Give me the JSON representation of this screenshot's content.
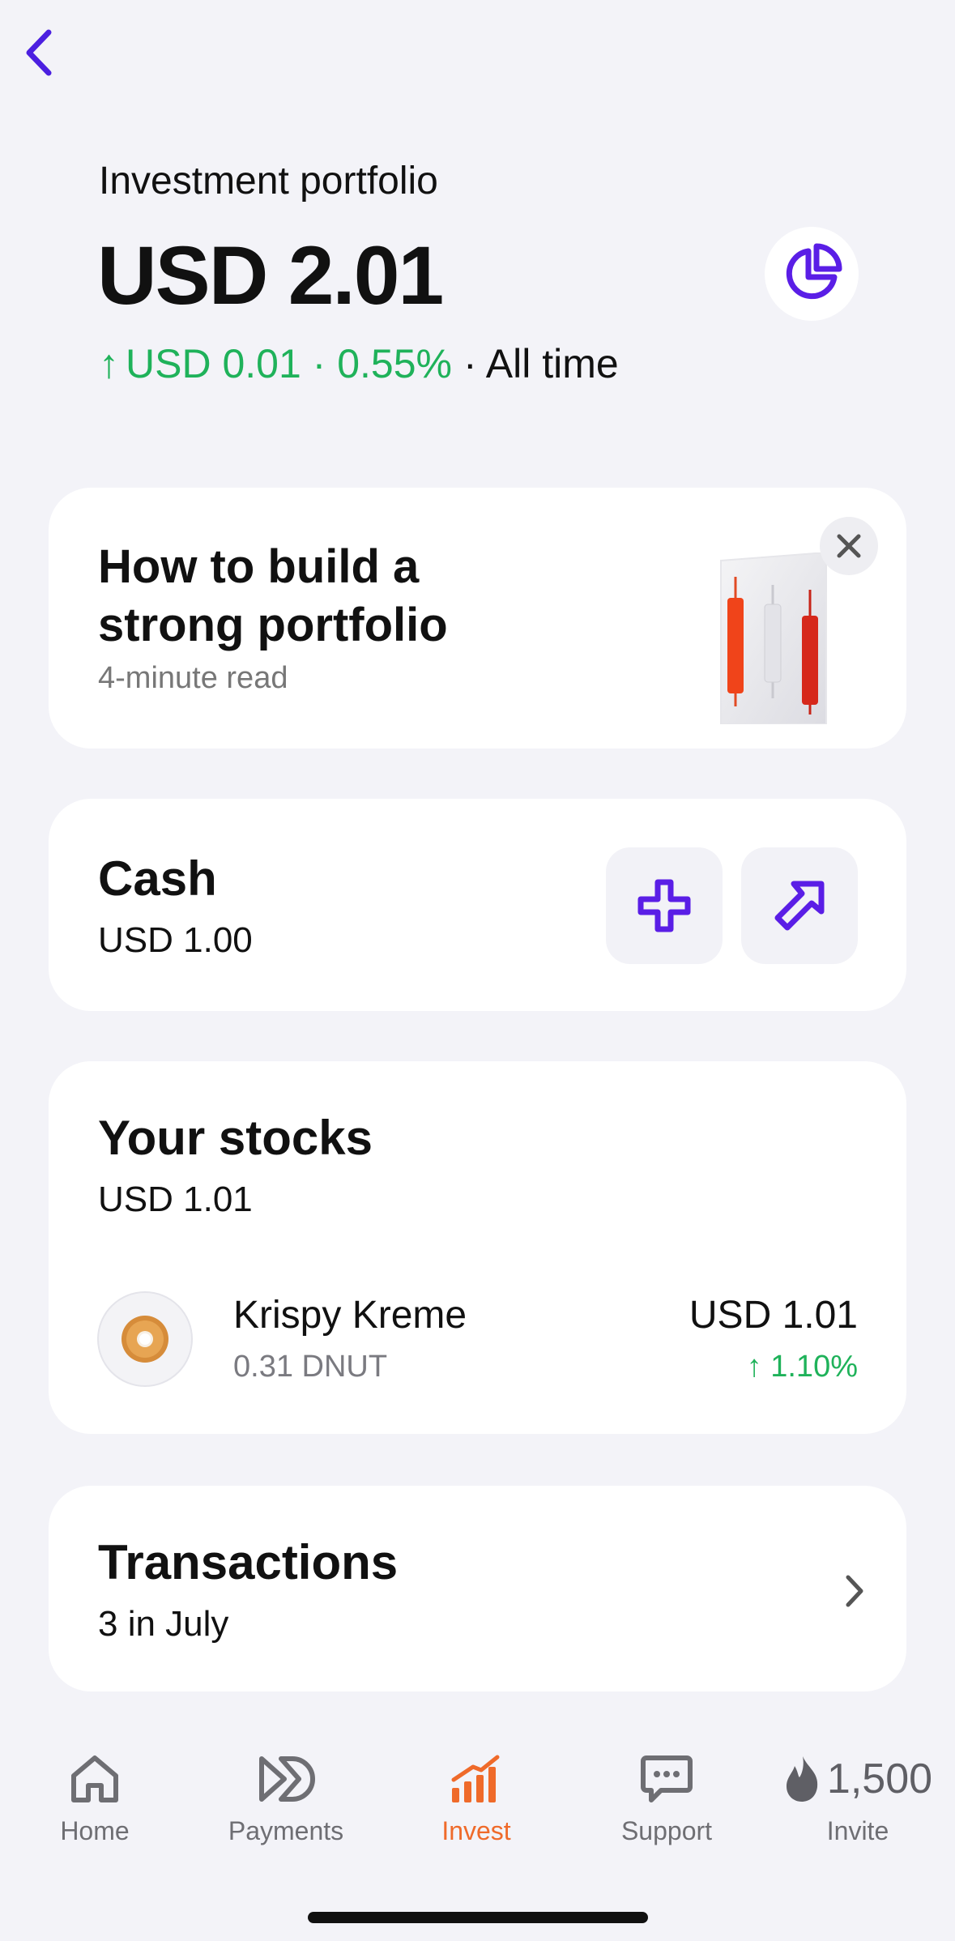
{
  "header": {
    "back_icon": "chevron-left-icon",
    "subtitle": "Investment portfolio",
    "total": "USD 2.01",
    "change_arrow": "↑",
    "change_amount": "USD 0.01 · 0.55%",
    "change_period": "· All time",
    "analytics_icon": "pie-chart-icon"
  },
  "promo": {
    "title": "How to build a strong portfolio",
    "subtitle": "4-minute read",
    "close_icon": "close-icon"
  },
  "cash": {
    "title": "Cash",
    "value": "USD 1.00",
    "add_icon": "plus-icon",
    "send_icon": "arrow-up-right-icon"
  },
  "stocks": {
    "title": "Your stocks",
    "value": "USD 1.01",
    "items": [
      {
        "name": "Krispy Kreme",
        "quantity": "0.31 DNUT",
        "price": "USD 1.01",
        "change": "↑ 1.10%"
      }
    ]
  },
  "transactions": {
    "title": "Transactions",
    "subtitle": "3 in July"
  },
  "tabbar": {
    "tabs": [
      {
        "label": "Home",
        "icon": "home-icon"
      },
      {
        "label": "Payments",
        "icon": "payments-icon"
      },
      {
        "label": "Invest",
        "icon": "invest-icon",
        "active": true
      },
      {
        "label": "Support",
        "icon": "support-chat-icon"
      },
      {
        "label": "Invite",
        "icon": "flame-icon",
        "count": "1,500"
      }
    ]
  },
  "colors": {
    "accent": "#5a1ee6",
    "positive": "#1fb25a",
    "active_tab": "#ef6a2a",
    "background": "#f3f3f8"
  }
}
